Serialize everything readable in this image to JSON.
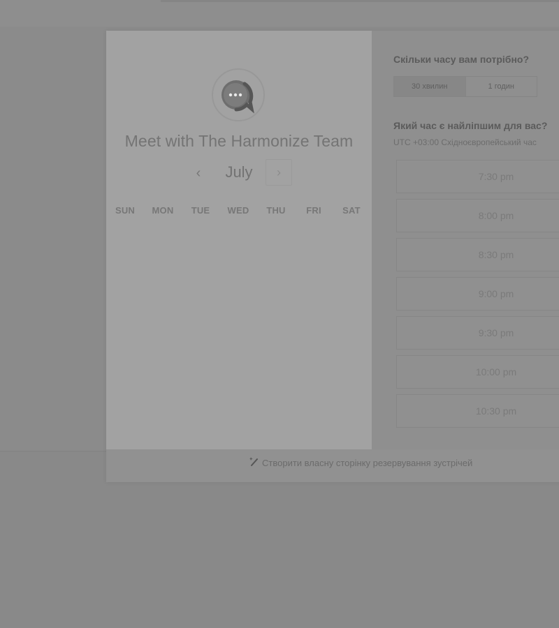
{
  "profile": {
    "title": "Meet with The Harmonize Team",
    "avatar_icon": "chat-bubble-icon"
  },
  "calendar": {
    "month": "July",
    "prev_icon": "chevron-left-icon",
    "next_icon": "chevron-right-icon",
    "weekdays": [
      "SUN",
      "MON",
      "TUE",
      "WED",
      "THU",
      "FRI",
      "SAT"
    ]
  },
  "duration": {
    "question": "Скільки часу вам потрібно?",
    "options": [
      "30 хвилин",
      "1 годин"
    ],
    "selected": "30 хвилин"
  },
  "time": {
    "question": "Який час є найліпшим для вас?",
    "timezone": "UTC +03:00 Східноєвропейський час",
    "slots": [
      "7:30 pm",
      "8:00 pm",
      "8:30 pm",
      "9:00 pm",
      "9:30 pm",
      "10:00 pm",
      "10:30 pm"
    ]
  },
  "footer": {
    "link_label": "Створити власну сторінку резервування зустрічей",
    "link_icon": "magic-wand-icon"
  }
}
